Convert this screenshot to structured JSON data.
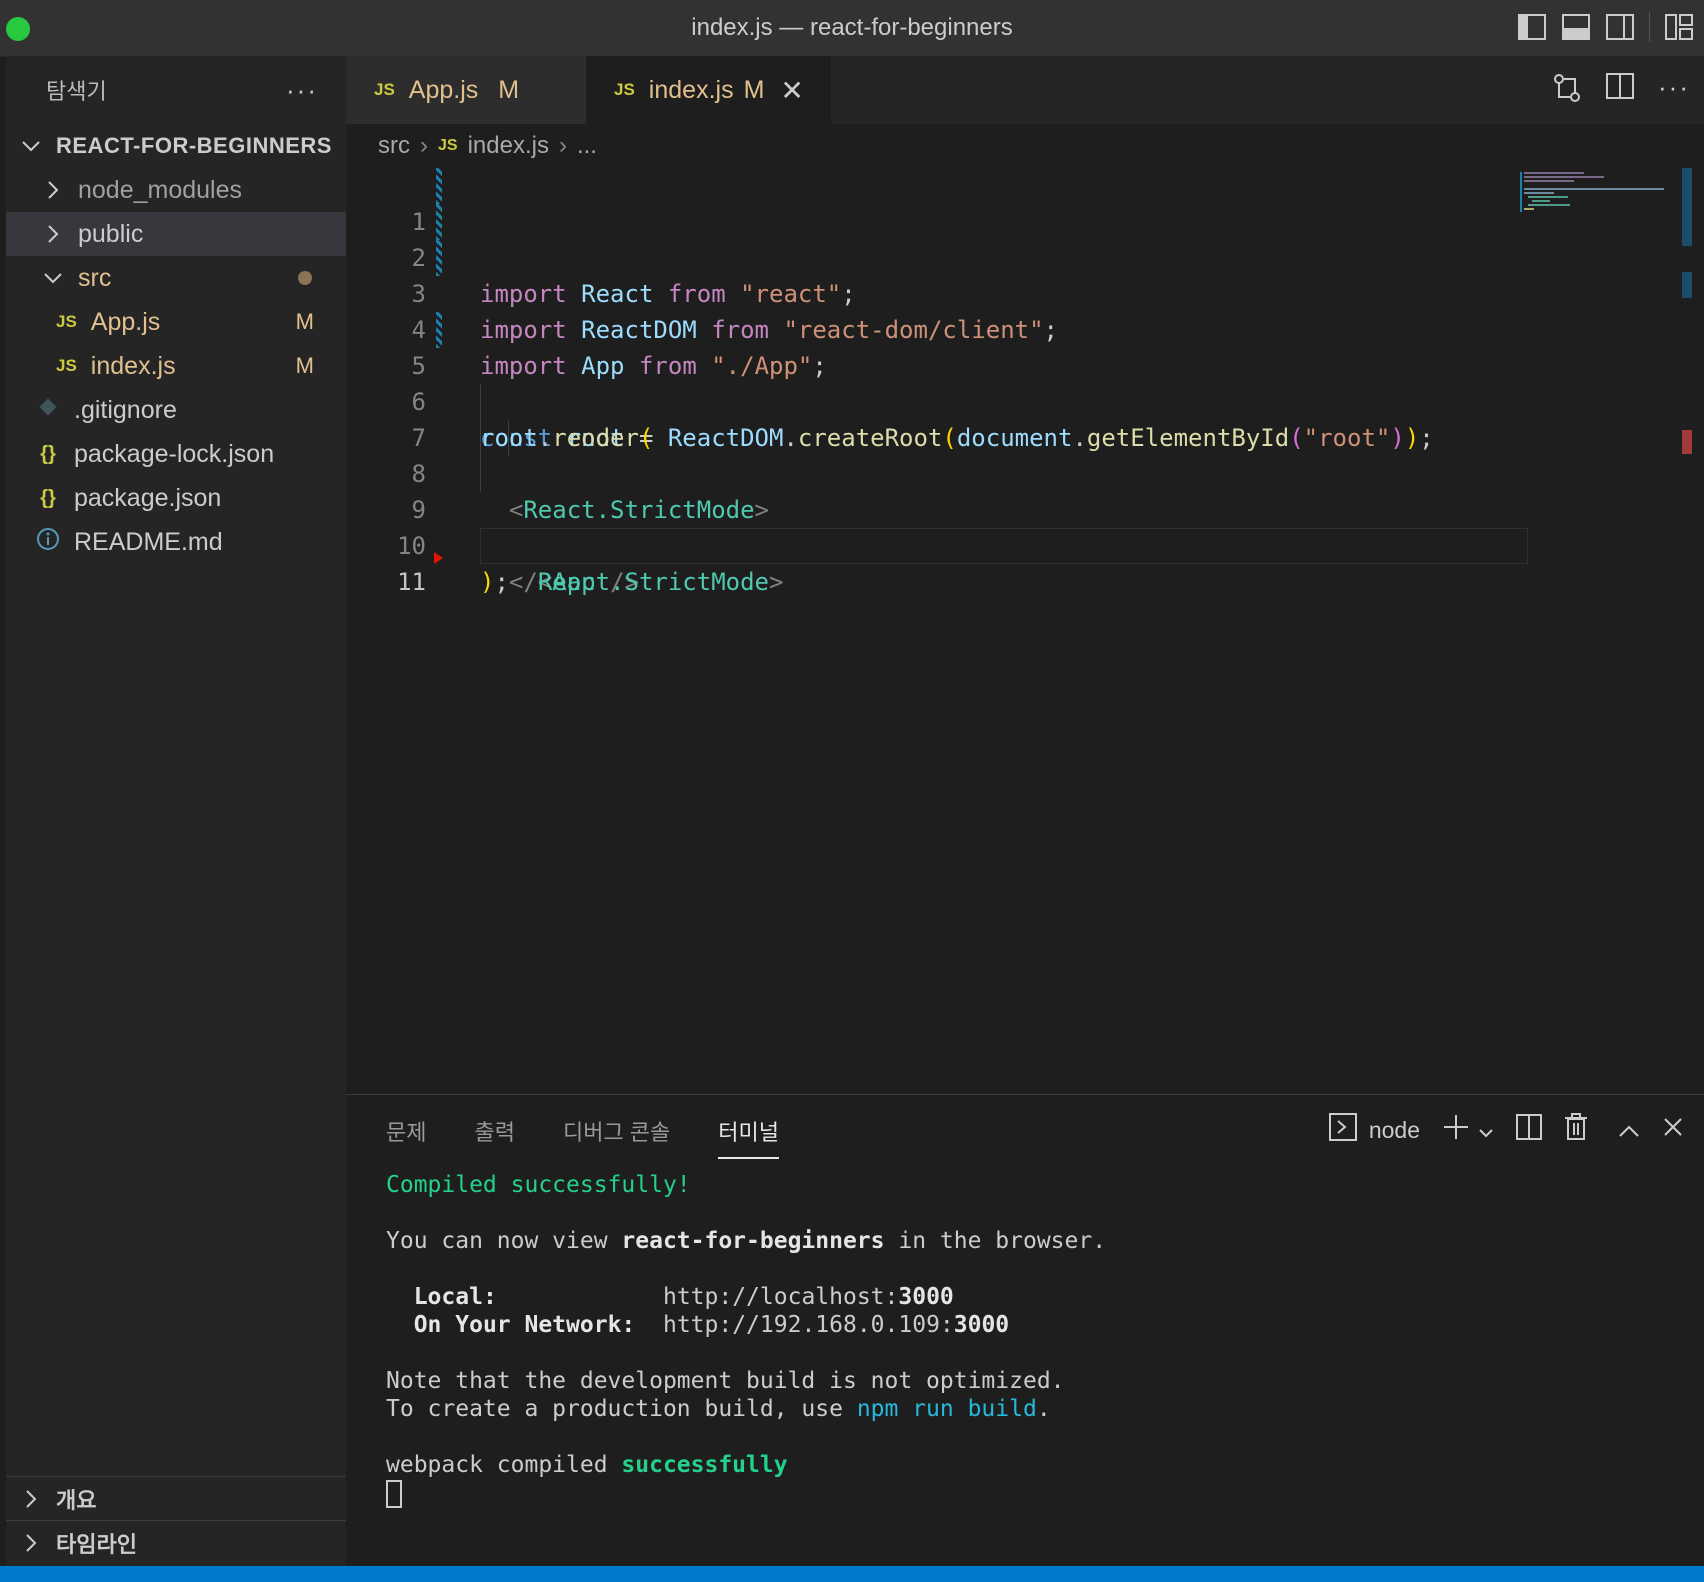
{
  "window": {
    "title": "index.js — react-for-beginners"
  },
  "sidebar": {
    "header": "탐색기",
    "project": "REACT-FOR-BEGINNERS",
    "items": [
      {
        "label": "node_modules",
        "type": "folder"
      },
      {
        "label": "public",
        "type": "folder"
      },
      {
        "label": "src",
        "type": "folder-open"
      },
      {
        "label": "App.js",
        "type": "js",
        "status": "M"
      },
      {
        "label": "index.js",
        "type": "js",
        "status": "M"
      },
      {
        "label": ".gitignore",
        "type": "git"
      },
      {
        "label": "package-lock.json",
        "type": "json"
      },
      {
        "label": "package.json",
        "type": "json"
      },
      {
        "label": "README.md",
        "type": "info"
      }
    ],
    "outline": "개요",
    "timeline": "타임라인"
  },
  "tabs": [
    {
      "badge": "JS",
      "label": "App.js",
      "status": "M"
    },
    {
      "badge": "JS",
      "label": "index.js",
      "status": "M"
    }
  ],
  "breadcrumb": {
    "folder": "src",
    "badge": "JS",
    "file": "index.js",
    "more": "..."
  },
  "editor": {
    "line_numbers": [
      "1",
      "2",
      "3",
      "4",
      "5",
      "6",
      "7",
      "8",
      "9",
      "10",
      "11"
    ],
    "lines": [
      "import React from \"react\";",
      "import ReactDOM from \"react-dom/client\";",
      "import App from \"./App\";",
      "",
      "const root = ReactDOM.createRoot(document.getElementById(\"root\"));",
      "root.render(",
      "  <React.StrictMode>",
      "    <App />",
      "  </React.StrictMode>",
      ");",
      ""
    ]
  },
  "panel": {
    "tabs": [
      "문제",
      "출력",
      "디버그 콘솔",
      "터미널"
    ],
    "active_tab": "터미널",
    "shell": "node",
    "terminal": {
      "compiled": "Compiled successfully!",
      "view_prefix": "You can now view ",
      "view_app": "react-for-beginners",
      "view_suffix": " in the browser.",
      "local_label": "Local:",
      "local_url": "http://localhost:",
      "local_port": "3000",
      "network_label": "On Your Network:",
      "network_url": "http://192.168.0.109:",
      "network_port": "3000",
      "note1": "Note that the development build is not optimized.",
      "note2_prefix": "To create a production build, use ",
      "note2_cmd": "npm run build",
      "note2_suffix": ".",
      "webpack_prefix": "webpack compiled ",
      "webpack_status": "successfully"
    }
  }
}
